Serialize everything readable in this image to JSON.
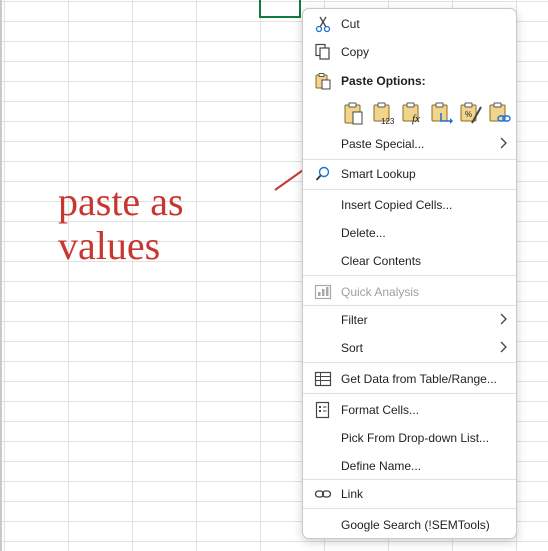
{
  "spreadsheet": {
    "active_cell_color": "#107c41",
    "gridline_color": "#e1e1e1"
  },
  "annotation": {
    "lines": [
      "paste as",
      "values"
    ],
    "color": "#c8372f"
  },
  "context_menu": {
    "items": {
      "cut": {
        "label": "Cut",
        "icon": "scissors-icon"
      },
      "copy": {
        "label": "Copy",
        "icon": "copy-icon"
      },
      "paste_options": {
        "label": "Paste Options:",
        "icon": "clipboard-icon"
      },
      "paste_special": {
        "label": "Paste Special...",
        "has_submenu": true
      },
      "smart_lookup": {
        "label": "Smart Lookup",
        "icon": "search-icon"
      },
      "insert_copied_cells": {
        "label": "Insert Copied Cells..."
      },
      "delete": {
        "label": "Delete..."
      },
      "clear_contents": {
        "label": "Clear Contents"
      },
      "quick_analysis": {
        "label": "Quick Analysis",
        "icon": "quick-analysis-icon",
        "disabled": true
      },
      "filter": {
        "label": "Filter",
        "has_submenu": true
      },
      "sort": {
        "label": "Sort",
        "has_submenu": true
      },
      "get_data": {
        "label": "Get Data from Table/Range...",
        "icon": "table-icon"
      },
      "format_cells": {
        "label": "Format Cells...",
        "icon": "format-cells-icon"
      },
      "pick_dropdown": {
        "label": "Pick From Drop-down List..."
      },
      "define_name": {
        "label": "Define Name..."
      },
      "link": {
        "label": "Link",
        "icon": "link-icon"
      },
      "google_search": {
        "label": "Google Search (!SEMTools)"
      }
    },
    "paste_buttons": [
      {
        "name": "paste",
        "icon": "paste-icon"
      },
      {
        "name": "values",
        "icon": "paste-values-icon",
        "badge": "123"
      },
      {
        "name": "formulas",
        "icon": "paste-formulas-icon",
        "badge": "fx"
      },
      {
        "name": "transpose",
        "icon": "paste-transpose-icon"
      },
      {
        "name": "formatting",
        "icon": "paste-formatting-icon",
        "badge": "%"
      },
      {
        "name": "paste_link",
        "icon": "paste-link-icon"
      }
    ]
  }
}
